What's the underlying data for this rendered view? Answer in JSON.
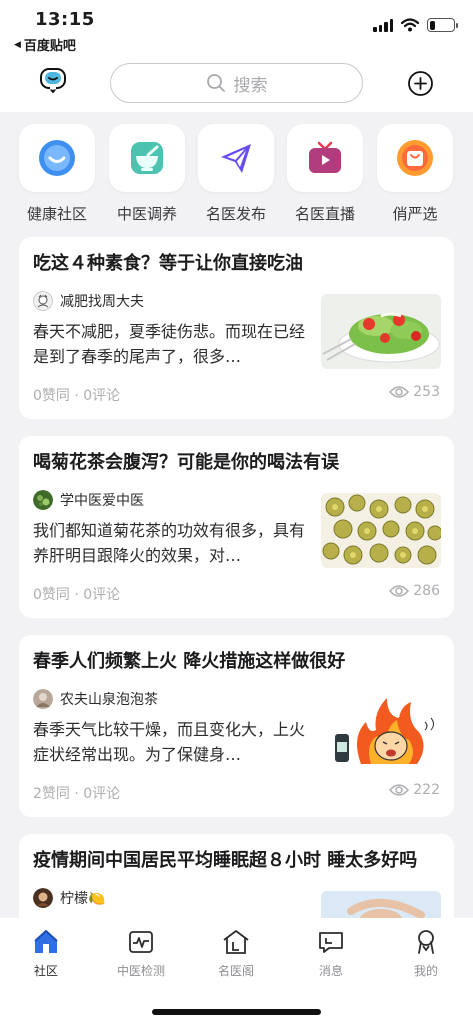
{
  "status_bar": {
    "time": "13:15",
    "back_app": "百度贴吧",
    "battery_level": 0.25
  },
  "header": {
    "search_placeholder": "搜索"
  },
  "shortcuts": [
    {
      "label": "健康社区",
      "icon": "community-icon"
    },
    {
      "label": "中医调养",
      "icon": "tcm-bowl-icon"
    },
    {
      "label": "名医发布",
      "icon": "publish-paper-plane-icon"
    },
    {
      "label": "名医直播",
      "icon": "live-tv-icon"
    },
    {
      "label": "俏严选",
      "icon": "shopping-bag-icon"
    }
  ],
  "feed": [
    {
      "title": "吃这４种素食？等于让你直接吃油",
      "author": "减肥找周大夫",
      "excerpt": "春天不减肥，夏季徒伤悲。而现在已经是到了春季的尾声了，很多…",
      "stats": "0赞同 · 0评论",
      "views": "253",
      "thumb": "salad-image"
    },
    {
      "title": "喝菊花茶会腹泻？可能是你的喝法有误",
      "author": "学中医爱中医",
      "excerpt": "我们都知道菊花茶的功效有很多，具有养肝明目跟降火的效果，对…",
      "stats": "0赞同 · 0评论",
      "views": "286",
      "thumb": "chrysanthemum-image"
    },
    {
      "title": "春季人们频繁上火 降火措施这样做很好",
      "author": "农夫山泉泡泡茶",
      "excerpt": "春季天气比较干燥，而且变化大，上火症状经常出现。为了保健身…",
      "stats": "2赞同 · 0评论",
      "views": "222",
      "thumb": "fire-cartoon-image"
    },
    {
      "title": "疫情期间中国居民平均睡眠超８小时 睡太多好吗",
      "author": "柠檬🍋",
      "excerpt": "",
      "stats": "",
      "views": "",
      "thumb": "sleep-image"
    }
  ],
  "tabbar": [
    {
      "label": "社区",
      "icon": "home-icon",
      "active": true
    },
    {
      "label": "中医检测",
      "icon": "pulse-monitor-icon",
      "active": false
    },
    {
      "label": "名医阁",
      "icon": "pavilion-icon",
      "active": false
    },
    {
      "label": "消息",
      "icon": "message-icon",
      "active": false
    },
    {
      "label": "我的",
      "icon": "profile-icon",
      "active": false
    }
  ],
  "colors": {
    "accent": "#2f6fe4",
    "background": "#f2f2f4",
    "muted": "#aeaeb2"
  }
}
